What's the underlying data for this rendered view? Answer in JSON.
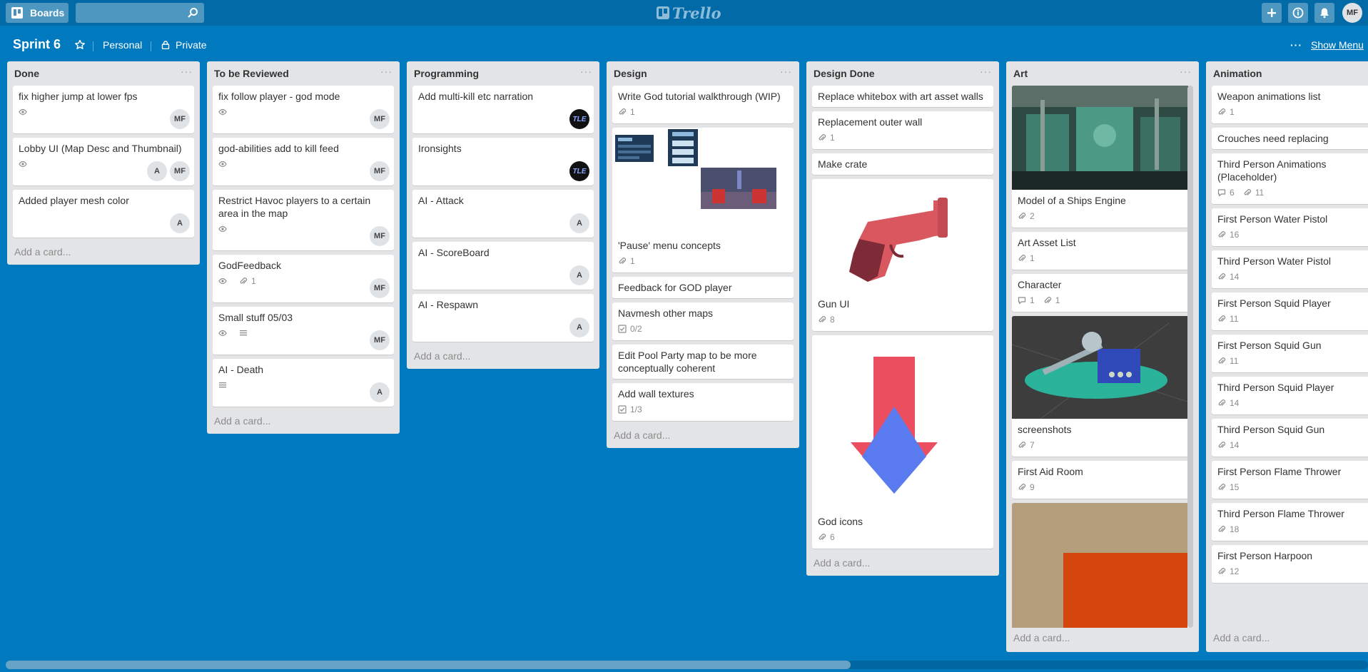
{
  "header": {
    "boards_label": "Boards",
    "logo_text": "Trello",
    "avatar": "MF"
  },
  "board": {
    "title": "Sprint 6",
    "team": "Personal",
    "visibility": "Private",
    "show_menu": "Show Menu",
    "menu_dots": "···"
  },
  "lists": [
    {
      "title": "Done",
      "add_card": "Add a card...",
      "cards": [
        {
          "title": "fix higher jump at lower fps",
          "members": [
            "MF"
          ]
        },
        {
          "title": "Lobby UI (Map Desc and Thumbnail)",
          "members": [
            "A",
            "MF"
          ]
        },
        {
          "title": "Added player mesh color",
          "members": [
            "A"
          ]
        }
      ]
    },
    {
      "title": "To be Reviewed",
      "add_card": "Add a card...",
      "cards": [
        {
          "title": "fix follow player - god mode",
          "members": [
            "MF"
          ]
        },
        {
          "title": "god-abilities add to kill feed",
          "members": [
            "MF"
          ]
        },
        {
          "title": "Restrict Havoc players to a certain area in the map",
          "members": [
            "MF"
          ]
        },
        {
          "title": "GodFeedback",
          "attachments": "1",
          "members": [
            "MF"
          ]
        },
        {
          "title": "Small stuff 05/03",
          "members": [
            "MF"
          ]
        },
        {
          "title": "AI - Death",
          "members": [
            "A"
          ]
        }
      ]
    },
    {
      "title": "Programming",
      "add_card": "Add a card...",
      "cards": [
        {
          "title": "Add multi-kill etc narration",
          "members": [
            "TLE"
          ]
        },
        {
          "title": "Ironsights",
          "members": [
            "TLE"
          ]
        },
        {
          "title": "AI - Attack",
          "members": [
            "A"
          ]
        },
        {
          "title": "AI - ScoreBoard",
          "members": [
            "A"
          ]
        },
        {
          "title": "AI - Respawn",
          "members": [
            "A"
          ]
        }
      ]
    },
    {
      "title": "Design",
      "add_card": "Add a card...",
      "cards": [
        {
          "title": "Write God tutorial walkthrough (WIP)",
          "attachments": "1"
        },
        {
          "title": "'Pause' menu concepts",
          "attachments": "1"
        },
        {
          "title": "Feedback for GOD player"
        },
        {
          "title": "Navmesh other maps",
          "checklist": "0/2"
        },
        {
          "title": "Edit Pool Party map to be more conceptually coherent"
        },
        {
          "title": "Add wall textures",
          "checklist": "1/3"
        }
      ]
    },
    {
      "title": "Design Done",
      "add_card": "Add a card...",
      "cards": [
        {
          "title": "Replace whitebox with art asset walls"
        },
        {
          "title": "Replacement outer wall",
          "attachments": "1"
        },
        {
          "title": "Make crate"
        },
        {
          "title": "Gun UI",
          "attachments": "8"
        },
        {
          "title": "God icons",
          "attachments": "6"
        }
      ]
    },
    {
      "title": "Art",
      "add_card": "Add a card...",
      "cards": [
        {
          "title": "Model of a Ships Engine",
          "attachments": "2"
        },
        {
          "title": "Art Asset List",
          "attachments": "1"
        },
        {
          "title": "Character",
          "comments": "1",
          "attachments": "1"
        },
        {
          "title": "screenshots",
          "attachments": "7"
        },
        {
          "title": "First Aid Room",
          "attachments": "9"
        }
      ]
    },
    {
      "title": "Animation",
      "add_card": "Add a card...",
      "cards": [
        {
          "title": "Weapon animations list",
          "attachments": "1"
        },
        {
          "title": "Crouches need replacing"
        },
        {
          "title": "Third Person Animations (Placeholder)",
          "comments": "6",
          "attachments": "11"
        },
        {
          "title": "First Person Water Pistol",
          "attachments": "16"
        },
        {
          "title": "Third Person Water Pistol",
          "attachments": "14"
        },
        {
          "title": "First Person Squid Player",
          "attachments": "11"
        },
        {
          "title": "First Person Squid Gun",
          "attachments": "11"
        },
        {
          "title": "Third Person Squid Player",
          "attachments": "14"
        },
        {
          "title": "Third Person Squid Gun",
          "attachments": "14"
        },
        {
          "title": "First Person Flame Thrower",
          "attachments": "15"
        },
        {
          "title": "Third Person Flame Thrower",
          "attachments": "18"
        },
        {
          "title": "First Person Harpoon",
          "attachments": "12"
        }
      ]
    }
  ],
  "colors": {
    "board_bg": "#0079bf",
    "header_bg": "#026aa7",
    "list_bg": "#e2e4e6"
  }
}
